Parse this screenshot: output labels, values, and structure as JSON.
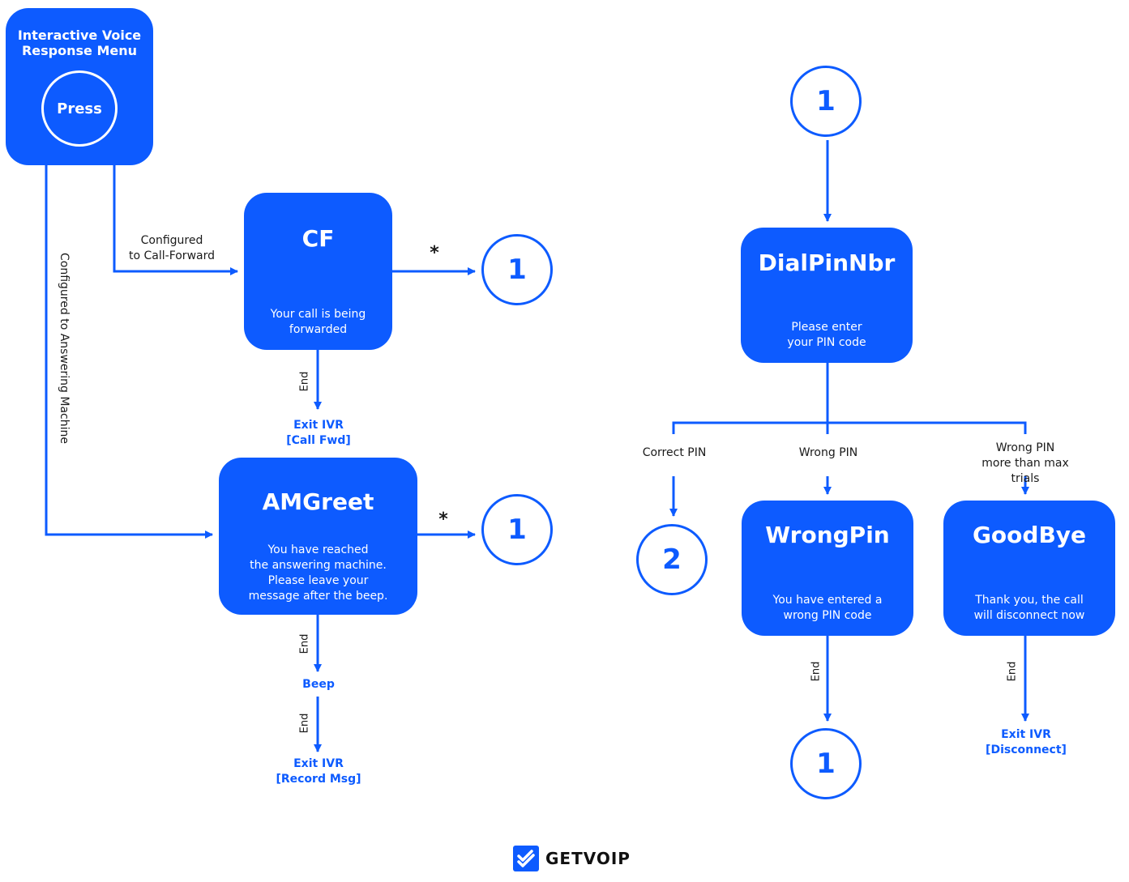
{
  "colors": {
    "accent": "#0d5bff",
    "text": "#1a1a1a"
  },
  "ivr": {
    "title": "Interactive Voice\nResponse Menu",
    "press": "Press"
  },
  "edges": {
    "call_forward": "Configured\nto Call-Forward",
    "answering_machine": "Configured to Answering Machine",
    "star": "*",
    "end": "End"
  },
  "cf": {
    "title": "CF",
    "desc": "Your call is being\nforwarded",
    "exit": "Exit IVR\n[Call Fwd]"
  },
  "amgreet": {
    "title": "AMGreet",
    "desc": "You have reached\nthe answering machine.\nPlease leave your\nmessage after the beep.",
    "beep": "Beep",
    "exit": "Exit IVR\n[Record Msg]"
  },
  "connectors": {
    "one": "1",
    "two": "2"
  },
  "dialpin": {
    "title": "DialPinNbr",
    "desc": "Please enter\nyour PIN code"
  },
  "branches": {
    "correct": "Correct PIN",
    "wrong": "Wrong PIN",
    "max": "Wrong PIN\nmore than max trials"
  },
  "wrongpin": {
    "title": "WrongPin",
    "desc": "You have entered a\nwrong PIN code"
  },
  "goodbye": {
    "title": "GoodBye",
    "desc": "Thank you, the call\nwill disconnect now",
    "exit": "Exit IVR\n[Disconnect]"
  },
  "logo": {
    "text": "GETVOIP",
    "icon": "double-check-icon"
  }
}
